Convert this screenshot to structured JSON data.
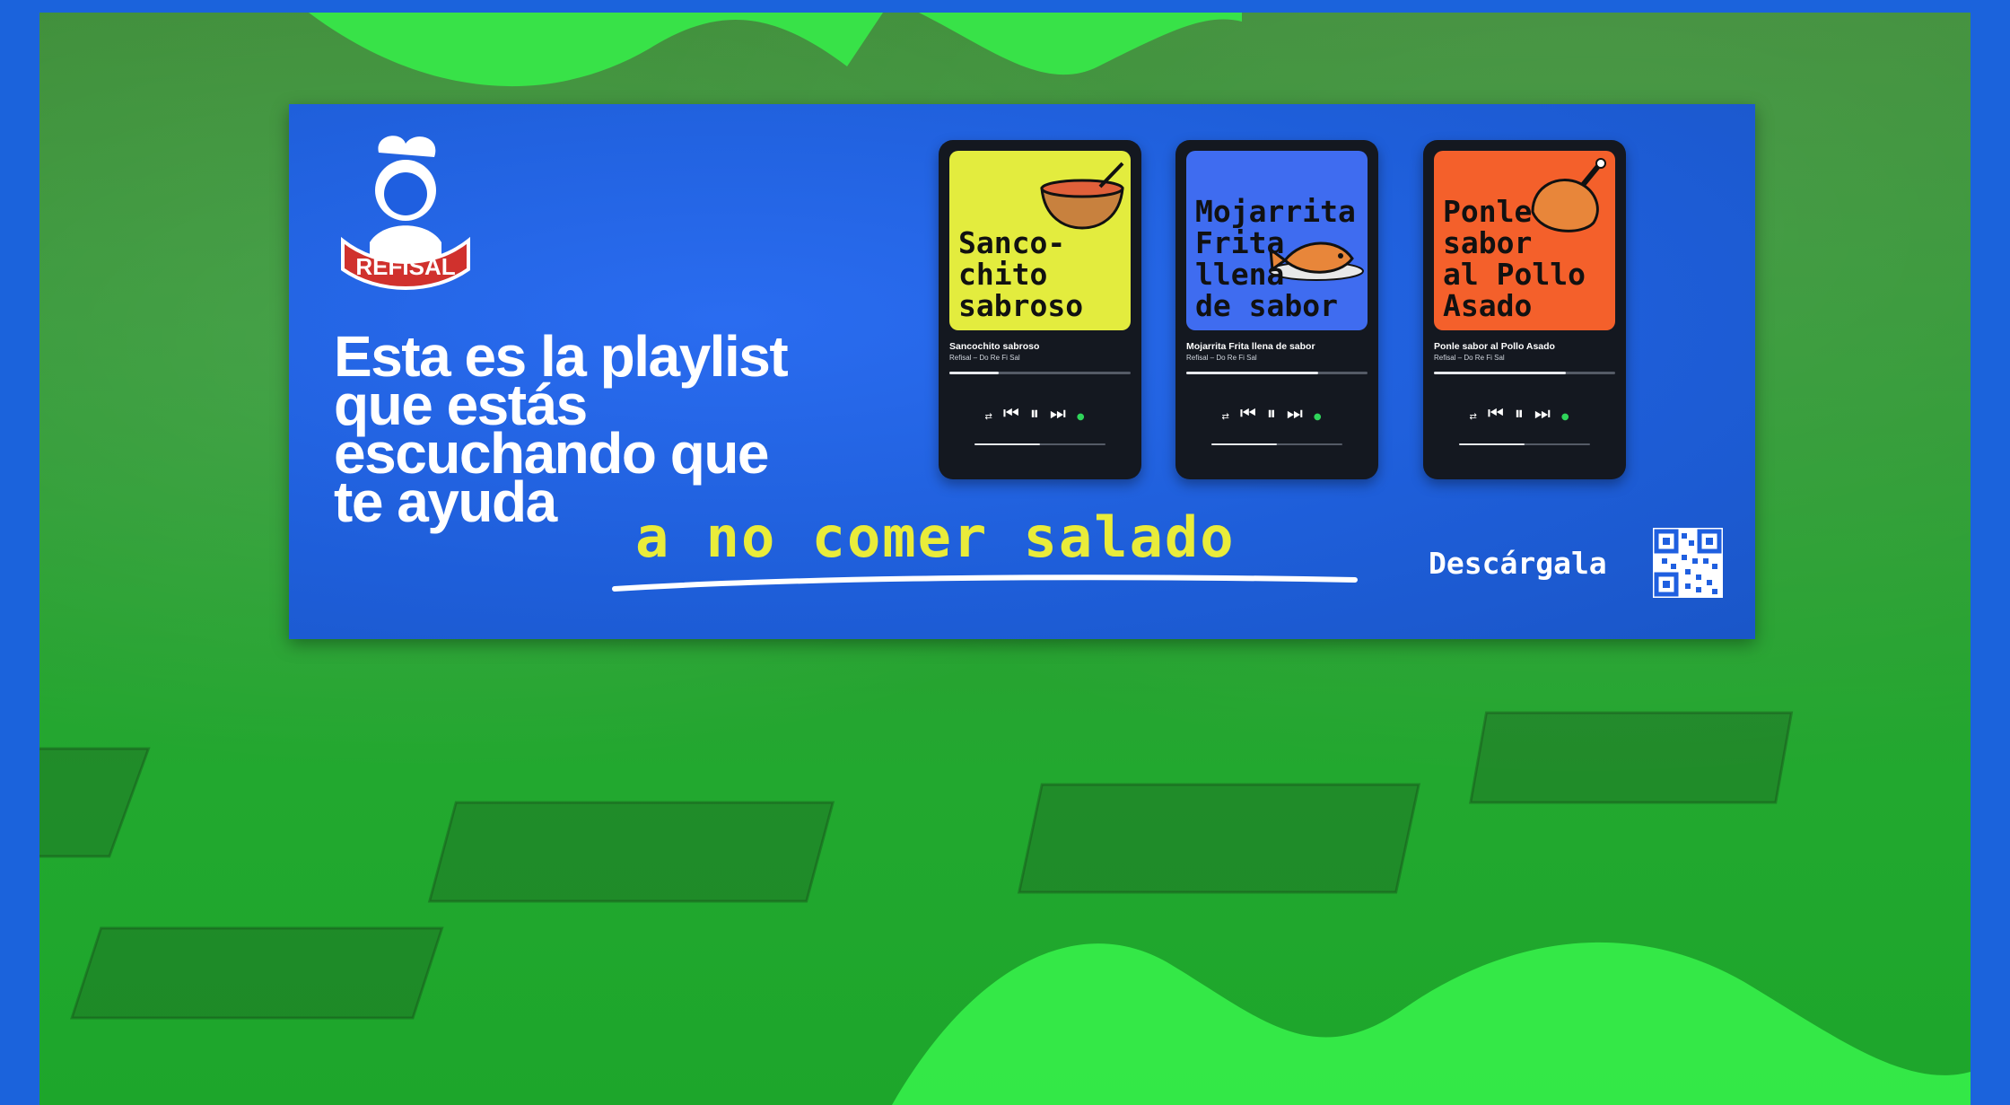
{
  "headline": {
    "lines": [
      "Esta es la playlist",
      "que estás",
      "escuchando que",
      "te ayuda"
    ],
    "accent": "a no comer salado"
  },
  "brand": {
    "name": "REFISAL"
  },
  "cta": {
    "label": "Descárgala"
  },
  "colors": {
    "frame": "#1b63dc",
    "billboard": "#1f5fe0",
    "accent": "#e9ec3a",
    "wave": "#36f04a"
  },
  "playlists": [
    {
      "cover_title": "Sanco-\nchito\nsabroso",
      "cover_color": "#e3ec3e",
      "song": "Sancochito sabroso",
      "artist": "Refisal – Do Re Fi Sal",
      "progress": 0.27,
      "art_icon": "soup-bowl-icon"
    },
    {
      "cover_title": "Mojarrita\nFrita\nllena\nde sabor",
      "cover_color": "#3f6cf0",
      "song": "Mojarrita Frita llena de sabor",
      "artist": "Refisal – Do Re Fi Sal",
      "progress": 0.73,
      "art_icon": "fish-icon"
    },
    {
      "cover_title": "Ponle\nsabor\nal Pollo\nAsado",
      "cover_color": "#f4602b",
      "song": "Ponle sabor al Pollo Asado",
      "artist": "Refisal – Do Re Fi Sal",
      "progress": 0.73,
      "art_icon": "roast-chicken-icon"
    }
  ]
}
